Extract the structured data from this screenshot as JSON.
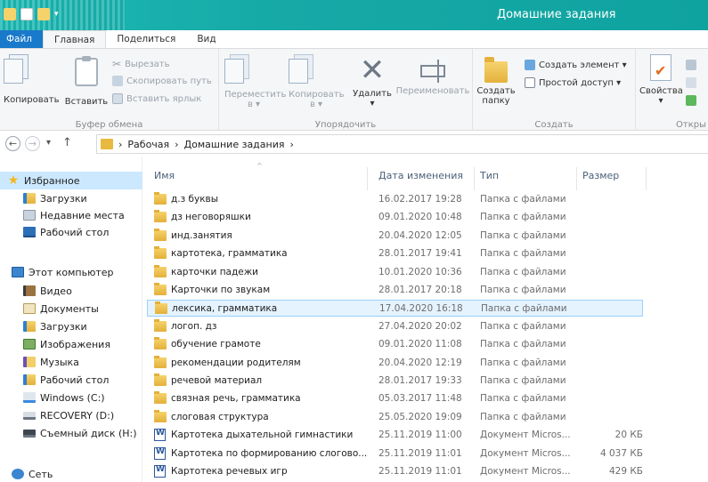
{
  "window": {
    "title": "Домашние задания",
    "accent": "#1979ca",
    "titlebar_color": "#16a9a6"
  },
  "tabs": {
    "file": "Файл",
    "home": "Главная",
    "share": "Поделиться",
    "view": "Вид"
  },
  "ribbon": {
    "clipboard": {
      "copy": "Копировать",
      "paste": "Вставить",
      "cut": "Вырезать",
      "copy_path": "Скопировать путь",
      "paste_shortcut": "Вставить ярлык",
      "label": "Буфер обмена"
    },
    "organize": {
      "move_to_l1": "Переместить",
      "move_to_l2": "в ▾",
      "copy_to_l1": "Копировать",
      "copy_to_l2": "в ▾",
      "delete": "Удалить",
      "delete_arrow": "▾",
      "rename": "Переименовать",
      "label": "Упорядочить"
    },
    "new": {
      "new_folder_l1": "Создать",
      "new_folder_l2": "папку",
      "new_item": "Создать элемент ▾",
      "easy_access": "Простой доступ ▾",
      "label": "Создать"
    },
    "open": {
      "properties": "Свойства",
      "properties_arrow": "▾",
      "label": "Откры"
    }
  },
  "address": {
    "back_icon": "←",
    "forward_icon": "→",
    "recent_icon": "▾",
    "up_icon": "↑",
    "sep": "›",
    "crumbs": [
      "Рабочая",
      "Домашние задания"
    ]
  },
  "navpane": {
    "favorites": "Избранное",
    "fav_items": [
      "Загрузки",
      "Недавние места",
      "Рабочий стол"
    ],
    "computer": "Этот компьютер",
    "pc_items": [
      "Видео",
      "Документы",
      "Загрузки",
      "Изображения",
      "Музыка",
      "Рабочий стол",
      "Windows (C:)",
      "RECOVERY (D:)",
      "Съемный диск (H:)"
    ],
    "network": "Сеть"
  },
  "columns": {
    "name": "Имя",
    "date": "Дата изменения",
    "type": "Тип",
    "size": "Размер",
    "sort_icon": "^"
  },
  "files": [
    {
      "name": "д.з буквы",
      "date": "16.02.2017 19:28",
      "type": "Папка с файлами",
      "size": "",
      "kind": "folder"
    },
    {
      "name": "дз неговоряшки",
      "date": "09.01.2020 10:48",
      "type": "Папка с файлами",
      "size": "",
      "kind": "folder"
    },
    {
      "name": "инд.занятия",
      "date": "20.04.2020 12:05",
      "type": "Папка с файлами",
      "size": "",
      "kind": "folder"
    },
    {
      "name": "картотека, грамматика",
      "date": "28.01.2017 19:41",
      "type": "Папка с файлами",
      "size": "",
      "kind": "folder"
    },
    {
      "name": "карточки падежи",
      "date": "10.01.2020 10:36",
      "type": "Папка с файлами",
      "size": "",
      "kind": "folder"
    },
    {
      "name": "Карточки по звукам",
      "date": "28.01.2017 20:18",
      "type": "Папка с файлами",
      "size": "",
      "kind": "folder"
    },
    {
      "name": "лексика, грамматика",
      "date": "17.04.2020 16:18",
      "type": "Папка с файлами",
      "size": "",
      "kind": "folder",
      "selected": true
    },
    {
      "name": "логоп. дз",
      "date": "27.04.2020 20:02",
      "type": "Папка с файлами",
      "size": "",
      "kind": "folder"
    },
    {
      "name": "обучение грамоте",
      "date": "09.01.2020 11:08",
      "type": "Папка с файлами",
      "size": "",
      "kind": "folder"
    },
    {
      "name": "рекомендации родителям",
      "date": "20.04.2020 12:19",
      "type": "Папка с файлами",
      "size": "",
      "kind": "folder"
    },
    {
      "name": "речевой материал",
      "date": "28.01.2017 19:33",
      "type": "Папка с файлами",
      "size": "",
      "kind": "folder"
    },
    {
      "name": "связная речь, грамматика",
      "date": "05.03.2017 11:48",
      "type": "Папка с файлами",
      "size": "",
      "kind": "folder"
    },
    {
      "name": "слоговая структура",
      "date": "25.05.2020 19:09",
      "type": "Папка с файлами",
      "size": "",
      "kind": "folder"
    },
    {
      "name": "Картотека дыхательной гимнастики",
      "date": "25.11.2019 11:00",
      "type": "Документ Micros...",
      "size": "20 КБ",
      "kind": "doc"
    },
    {
      "name": "Картотека по формированию слогово...",
      "date": "25.11.2019 11:01",
      "type": "Документ Micros...",
      "size": "4 037 КБ",
      "kind": "doc"
    },
    {
      "name": "Картотека речевых игр",
      "date": "25.11.2019 11:01",
      "type": "Документ Micros...",
      "size": "429 КБ",
      "kind": "doc"
    }
  ]
}
